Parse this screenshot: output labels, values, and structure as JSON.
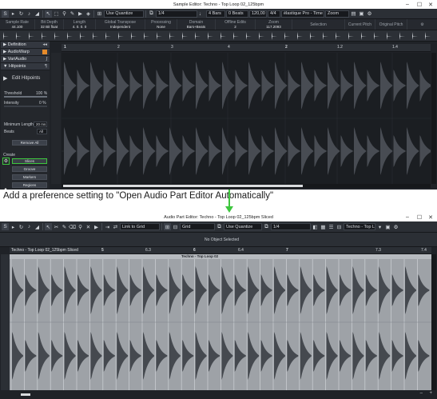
{
  "sample_editor": {
    "title": "Sample Editor: Techno - Top Loop 02_125bpm",
    "toolbar": {
      "quantize_mode": "Use Quantize",
      "quantize_value": "1/4",
      "length": "4 Bars",
      "beats": "0 Beats",
      "tempo": "120,00",
      "signature": "4/4",
      "algorithm": "élastique Pro - Time",
      "zoom": "Zoom"
    },
    "infoline": [
      {
        "header": "Sample Rate",
        "value": "44.100"
      },
      {
        "header": "Bit Depth",
        "value": "32 Bit float"
      },
      {
        "header": "Length",
        "value": "4. 0. 0. 0"
      },
      {
        "header": "Global Transpose",
        "value": "Independent"
      },
      {
        "header": "Processing",
        "value": "None"
      },
      {
        "header": "Domain",
        "value": "Bars+Beats"
      },
      {
        "header": "Offline Edits",
        "value": "2"
      },
      {
        "header": "Zoom",
        "value": "117.2093"
      },
      {
        "header": "Selection",
        "value": ""
      },
      {
        "header": "Current Pitch",
        "value": ""
      },
      {
        "header": "Original Pitch",
        "value": ""
      }
    ],
    "inspector": {
      "sections": [
        "Definition",
        "AudioWarp",
        "VariAudio",
        "Hitpoints"
      ],
      "edit_hitpoints": "Edit Hitpoints",
      "threshold_label": "Threshold",
      "threshold_value": "100 %",
      "intensity_label": "Intensity",
      "intensity_value": "0 %",
      "min_length_label": "Minimum Length",
      "min_length_value": "20 ms",
      "beats_label": "Beats",
      "beats_value": "All",
      "remove_all": "Remove All",
      "create_label": "Create",
      "create_buttons": [
        "Slices",
        "Groove",
        "Markers",
        "Regions"
      ]
    },
    "ruler": [
      "2",
      "3",
      "4",
      "1.2",
      "1.3",
      "1.4"
    ]
  },
  "annotation": "Add a preference setting to \"Open Audio Part Editor Automatically\"",
  "part_editor": {
    "title": "Audio Part Editor: Techno - Top Loop 02_125bpm Sliced",
    "toolbar": {
      "link_grid": "Link to Grid",
      "grid": "Grid",
      "quantize_mode": "Use Quantize",
      "quantize_value": "1/4",
      "part_name": "Techno - Top L..."
    },
    "status": "No Object Selected",
    "track_name": "Techno - Top Loop 02_125bpm Sliced",
    "part_label": "Techno - Top Loop 02",
    "ruler": [
      "5",
      "6.3",
      "7",
      "6",
      "6.4",
      "7.3",
      "7.4"
    ]
  },
  "colors": {
    "accent_green": "#3ec63e",
    "waveform": "#4a4e55",
    "slice_bg": "#9ea2a7"
  }
}
